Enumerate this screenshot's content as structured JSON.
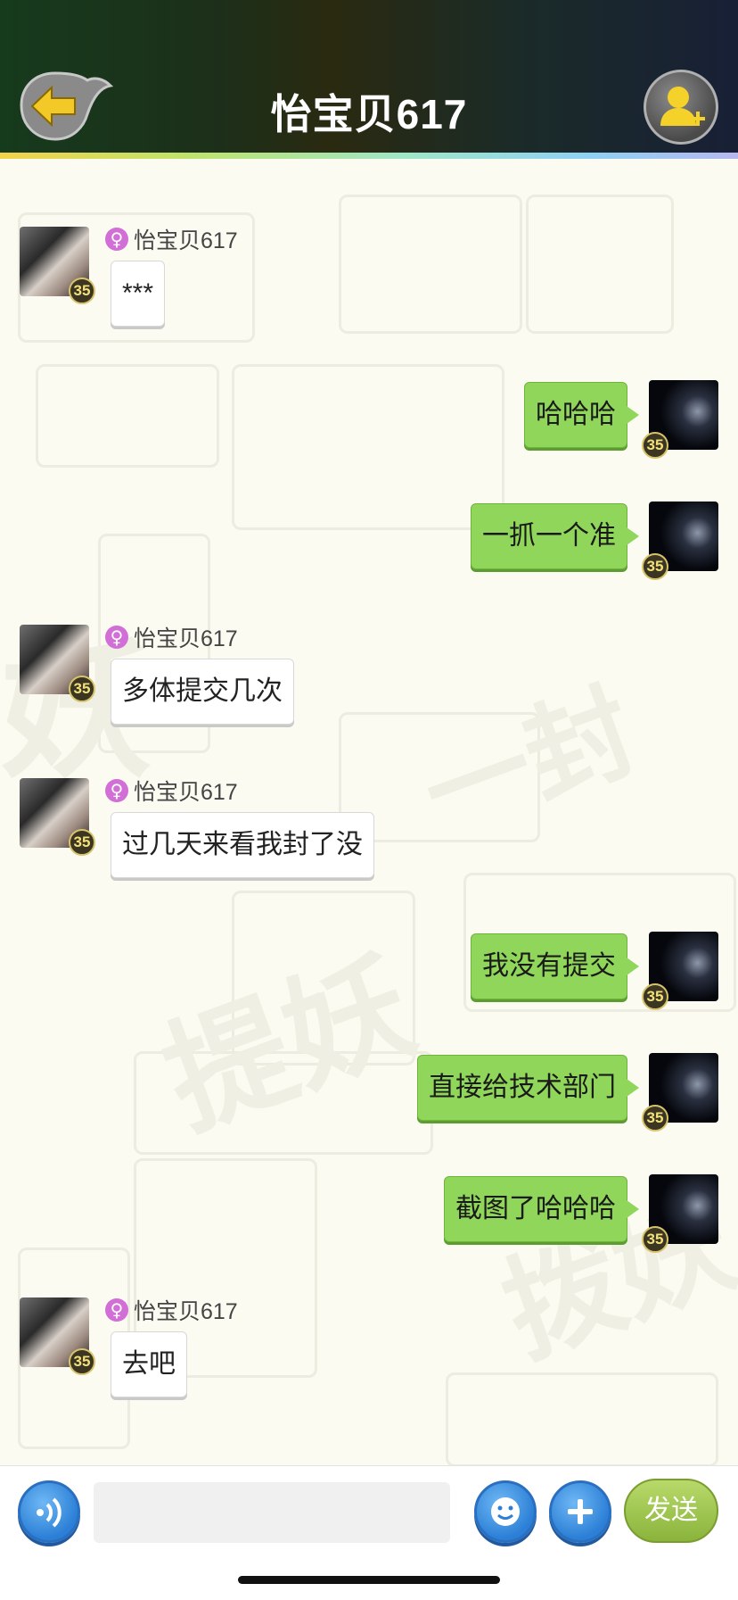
{
  "header": {
    "title": "怡宝贝617"
  },
  "messages": [
    {
      "side": "in",
      "sender": "怡宝贝617",
      "text": "***",
      "level": "35"
    },
    {
      "side": "out",
      "text": "哈哈哈",
      "level": "35"
    },
    {
      "side": "out",
      "text": "一抓一个准",
      "level": "35"
    },
    {
      "side": "in",
      "sender": "怡宝贝617",
      "text": "多体提交几次",
      "level": "35"
    },
    {
      "side": "in",
      "sender": "怡宝贝617",
      "text": "过几天来看我封了没",
      "level": "35"
    },
    {
      "side": "out",
      "text": "我没有提交",
      "level": "35"
    },
    {
      "side": "out",
      "text": "直接给技术部门",
      "level": "35"
    },
    {
      "side": "out",
      "text": "截图了哈哈哈",
      "level": "35"
    },
    {
      "side": "in",
      "sender": "怡宝贝617",
      "text": "去吧",
      "level": "35"
    }
  ],
  "input": {
    "value": "",
    "send_label": "发送"
  },
  "colors": {
    "outgoing_bubble": "#8fd65a",
    "incoming_bubble": "#ffffff",
    "accent_blue": "#2b7fd6",
    "gender_female": "#d26fd6"
  },
  "icons": {
    "back": "arrow-left-icon",
    "add_friend": "add-friend-icon",
    "voice": "voice-icon",
    "emoji": "emoji-icon",
    "plus": "plus-icon",
    "gender": "female-icon"
  }
}
